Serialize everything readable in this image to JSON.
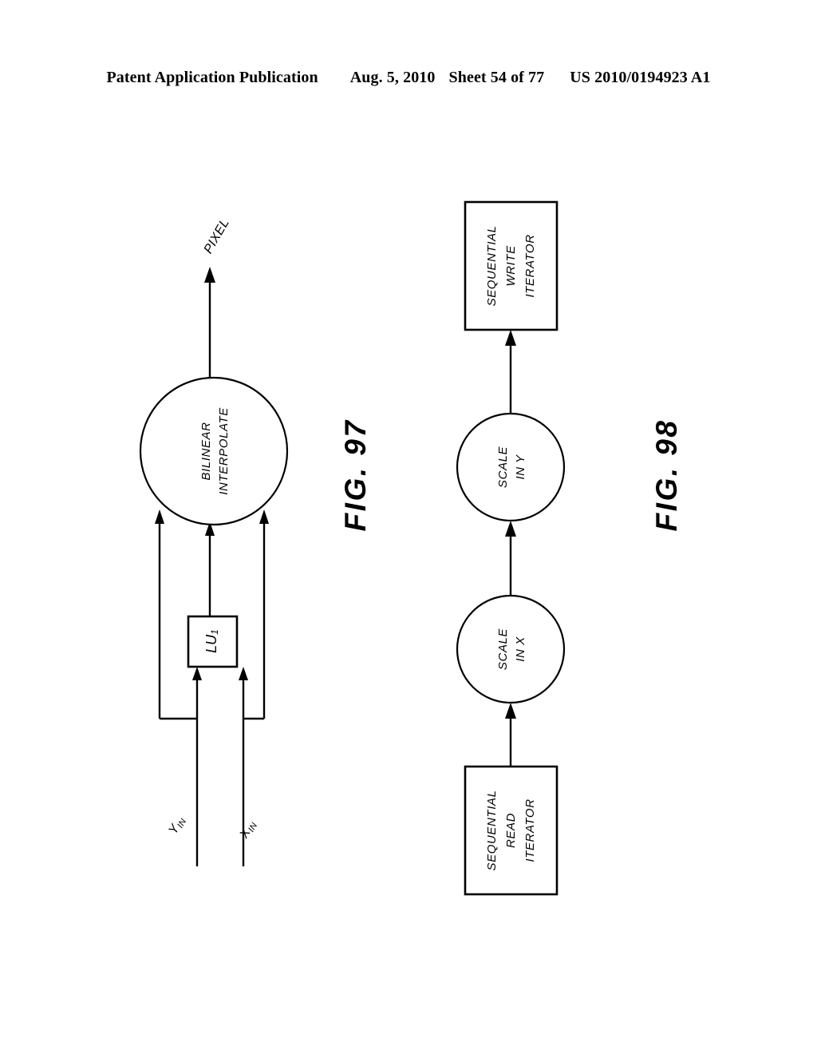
{
  "header": {
    "publication": "Patent Application Publication",
    "date": "Aug. 5, 2010",
    "sheet": "Sheet 54 of 77",
    "patent_number": "US 2010/0194923 A1"
  },
  "figures": [
    {
      "caption": "FIG. 97",
      "nodes": {
        "output_signal": "PIXEL",
        "process_line1": "BILINEAR",
        "process_line2": "INTERPOLATE",
        "lookup_box": "LU",
        "lookup_box_sub": "1",
        "input_y": "Y",
        "input_y_sub": "IN",
        "input_x": "X",
        "input_x_sub": "IN"
      }
    },
    {
      "caption": "FIG. 98",
      "nodes": {
        "write_iterator_line1": "SEQUENTIAL",
        "write_iterator_line2": "WRITE",
        "write_iterator_line3": "ITERATOR",
        "scale_y_line1": "SCALE",
        "scale_y_line2": "IN Y",
        "scale_x_line1": "SCALE",
        "scale_x_line2": "IN X",
        "read_iterator_line1": "SEQUENTIAL",
        "read_iterator_line2": "READ",
        "read_iterator_line3": "ITERATOR"
      }
    }
  ],
  "colors": {
    "ink": "#000000",
    "paper": "#ffffff"
  }
}
